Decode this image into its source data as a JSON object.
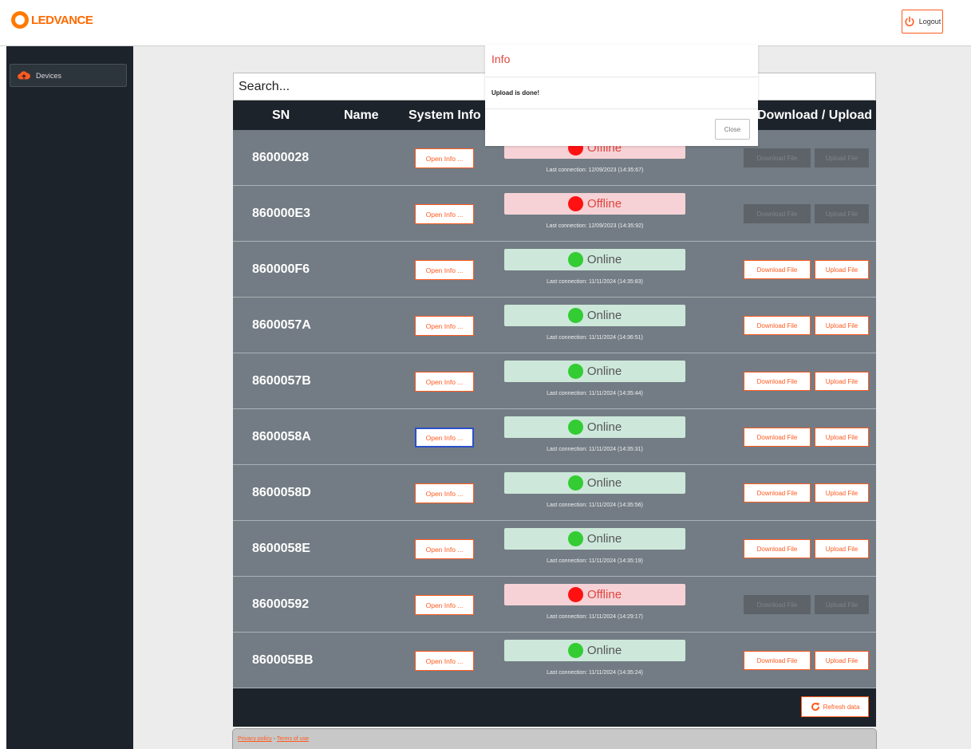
{
  "header": {
    "brand": "LEDVANCE",
    "logout_label": "Logout"
  },
  "sidebar": {
    "items": [
      {
        "label": "Devices",
        "icon": "cloud-upload-icon"
      }
    ]
  },
  "search": {
    "placeholder": "Search..."
  },
  "table": {
    "columns": [
      "SN",
      "Name",
      "System Info",
      "Download / Upload"
    ],
    "rows": [
      {
        "sn": "86000028",
        "name": "",
        "info_btn": "Open Info ...",
        "status": "Offline",
        "last_connection": "Last connection: 12/09/2023 (14:35:67)",
        "download": "Download File",
        "upload": "Upload File"
      },
      {
        "sn": "860000E3",
        "name": "",
        "info_btn": "Open Info ...",
        "status": "Offline",
        "last_connection": "Last connection: 12/09/2023 (14:35:92)",
        "download": "Download File",
        "upload": "Upload File"
      },
      {
        "sn": "860000F6",
        "name": "",
        "info_btn": "Open Info ...",
        "status": "Online",
        "last_connection": "Last connection: 11/11/2024 (14:35:83)",
        "download": "Download File",
        "upload": "Upload File"
      },
      {
        "sn": "8600057A",
        "name": "",
        "info_btn": "Open Info ...",
        "status": "Online",
        "last_connection": "Last connection: 11/11/2024 (14:36:51)",
        "download": "Download File",
        "upload": "Upload File"
      },
      {
        "sn": "8600057B",
        "name": "",
        "info_btn": "Open Info ...",
        "status": "Online",
        "last_connection": "Last connection: 11/11/2024 (14:35:44)",
        "download": "Download File",
        "upload": "Upload File"
      },
      {
        "sn": "8600058A",
        "name": "",
        "info_btn": "Open Info ...",
        "status": "Online",
        "last_connection": "Last connection: 11/11/2024 (14:35:31)",
        "download": "Download File",
        "upload": "Upload File"
      },
      {
        "sn": "8600058D",
        "name": "",
        "info_btn": "Open Info ...",
        "status": "Online",
        "last_connection": "Last connection: 11/11/2024 (14:35:56)",
        "download": "Download File",
        "upload": "Upload File"
      },
      {
        "sn": "8600058E",
        "name": "",
        "info_btn": "Open Info ...",
        "status": "Online",
        "last_connection": "Last connection: 11/11/2024 (14:35:19)",
        "download": "Download File",
        "upload": "Upload File"
      },
      {
        "sn": "86000592",
        "name": "",
        "info_btn": "Open Info ...",
        "status": "Offline",
        "last_connection": "Last connection: 11/11/2024 (14:29:17)",
        "download": "Download File",
        "upload": "Upload File"
      },
      {
        "sn": "860005BB",
        "name": "",
        "info_btn": "Open Info ...",
        "status": "Online",
        "last_connection": "Last connection: 11/11/2024 (14:35:24)",
        "download": "Download File",
        "upload": "Upload File"
      }
    ],
    "refresh_label": "Refresh data"
  },
  "footer": {
    "privacy": "Privacy policy",
    "separator": " - ",
    "terms": "Terms of use"
  },
  "modal": {
    "title": "Info",
    "message": "Upload is done!",
    "close_label": "Close"
  },
  "colors": {
    "accent": "#ff5a1f",
    "dark": "#1c232a",
    "row_bg": "#737c84",
    "online_bg": "#cde8da",
    "offline_bg": "#f6d2d6",
    "online_dot": "#33cc33",
    "offline_dot": "#ff1111"
  }
}
